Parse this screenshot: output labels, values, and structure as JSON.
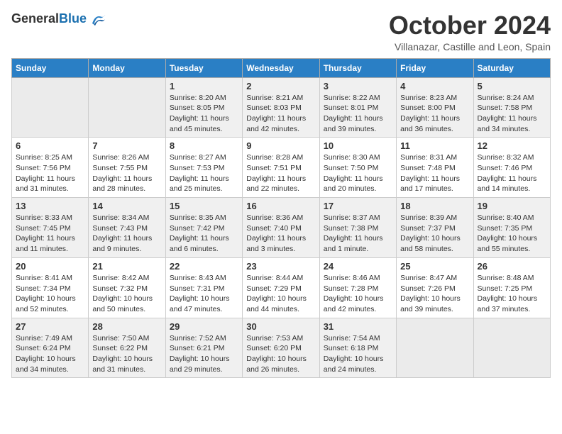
{
  "header": {
    "logo_general": "General",
    "logo_blue": "Blue",
    "month": "October 2024",
    "location": "Villanazar, Castille and Leon, Spain"
  },
  "columns": [
    "Sunday",
    "Monday",
    "Tuesday",
    "Wednesday",
    "Thursday",
    "Friday",
    "Saturday"
  ],
  "weeks": [
    [
      {
        "day": "",
        "content": ""
      },
      {
        "day": "",
        "content": ""
      },
      {
        "day": "1",
        "content": "Sunrise: 8:20 AM\nSunset: 8:05 PM\nDaylight: 11 hours and 45 minutes."
      },
      {
        "day": "2",
        "content": "Sunrise: 8:21 AM\nSunset: 8:03 PM\nDaylight: 11 hours and 42 minutes."
      },
      {
        "day": "3",
        "content": "Sunrise: 8:22 AM\nSunset: 8:01 PM\nDaylight: 11 hours and 39 minutes."
      },
      {
        "day": "4",
        "content": "Sunrise: 8:23 AM\nSunset: 8:00 PM\nDaylight: 11 hours and 36 minutes."
      },
      {
        "day": "5",
        "content": "Sunrise: 8:24 AM\nSunset: 7:58 PM\nDaylight: 11 hours and 34 minutes."
      }
    ],
    [
      {
        "day": "6",
        "content": "Sunrise: 8:25 AM\nSunset: 7:56 PM\nDaylight: 11 hours and 31 minutes."
      },
      {
        "day": "7",
        "content": "Sunrise: 8:26 AM\nSunset: 7:55 PM\nDaylight: 11 hours and 28 minutes."
      },
      {
        "day": "8",
        "content": "Sunrise: 8:27 AM\nSunset: 7:53 PM\nDaylight: 11 hours and 25 minutes."
      },
      {
        "day": "9",
        "content": "Sunrise: 8:28 AM\nSunset: 7:51 PM\nDaylight: 11 hours and 22 minutes."
      },
      {
        "day": "10",
        "content": "Sunrise: 8:30 AM\nSunset: 7:50 PM\nDaylight: 11 hours and 20 minutes."
      },
      {
        "day": "11",
        "content": "Sunrise: 8:31 AM\nSunset: 7:48 PM\nDaylight: 11 hours and 17 minutes."
      },
      {
        "day": "12",
        "content": "Sunrise: 8:32 AM\nSunset: 7:46 PM\nDaylight: 11 hours and 14 minutes."
      }
    ],
    [
      {
        "day": "13",
        "content": "Sunrise: 8:33 AM\nSunset: 7:45 PM\nDaylight: 11 hours and 11 minutes."
      },
      {
        "day": "14",
        "content": "Sunrise: 8:34 AM\nSunset: 7:43 PM\nDaylight: 11 hours and 9 minutes."
      },
      {
        "day": "15",
        "content": "Sunrise: 8:35 AM\nSunset: 7:42 PM\nDaylight: 11 hours and 6 minutes."
      },
      {
        "day": "16",
        "content": "Sunrise: 8:36 AM\nSunset: 7:40 PM\nDaylight: 11 hours and 3 minutes."
      },
      {
        "day": "17",
        "content": "Sunrise: 8:37 AM\nSunset: 7:38 PM\nDaylight: 11 hours and 1 minute."
      },
      {
        "day": "18",
        "content": "Sunrise: 8:39 AM\nSunset: 7:37 PM\nDaylight: 10 hours and 58 minutes."
      },
      {
        "day": "19",
        "content": "Sunrise: 8:40 AM\nSunset: 7:35 PM\nDaylight: 10 hours and 55 minutes."
      }
    ],
    [
      {
        "day": "20",
        "content": "Sunrise: 8:41 AM\nSunset: 7:34 PM\nDaylight: 10 hours and 52 minutes."
      },
      {
        "day": "21",
        "content": "Sunrise: 8:42 AM\nSunset: 7:32 PM\nDaylight: 10 hours and 50 minutes."
      },
      {
        "day": "22",
        "content": "Sunrise: 8:43 AM\nSunset: 7:31 PM\nDaylight: 10 hours and 47 minutes."
      },
      {
        "day": "23",
        "content": "Sunrise: 8:44 AM\nSunset: 7:29 PM\nDaylight: 10 hours and 44 minutes."
      },
      {
        "day": "24",
        "content": "Sunrise: 8:46 AM\nSunset: 7:28 PM\nDaylight: 10 hours and 42 minutes."
      },
      {
        "day": "25",
        "content": "Sunrise: 8:47 AM\nSunset: 7:26 PM\nDaylight: 10 hours and 39 minutes."
      },
      {
        "day": "26",
        "content": "Sunrise: 8:48 AM\nSunset: 7:25 PM\nDaylight: 10 hours and 37 minutes."
      }
    ],
    [
      {
        "day": "27",
        "content": "Sunrise: 7:49 AM\nSunset: 6:24 PM\nDaylight: 10 hours and 34 minutes."
      },
      {
        "day": "28",
        "content": "Sunrise: 7:50 AM\nSunset: 6:22 PM\nDaylight: 10 hours and 31 minutes."
      },
      {
        "day": "29",
        "content": "Sunrise: 7:52 AM\nSunset: 6:21 PM\nDaylight: 10 hours and 29 minutes."
      },
      {
        "day": "30",
        "content": "Sunrise: 7:53 AM\nSunset: 6:20 PM\nDaylight: 10 hours and 26 minutes."
      },
      {
        "day": "31",
        "content": "Sunrise: 7:54 AM\nSunset: 6:18 PM\nDaylight: 10 hours and 24 minutes."
      },
      {
        "day": "",
        "content": ""
      },
      {
        "day": "",
        "content": ""
      }
    ]
  ]
}
